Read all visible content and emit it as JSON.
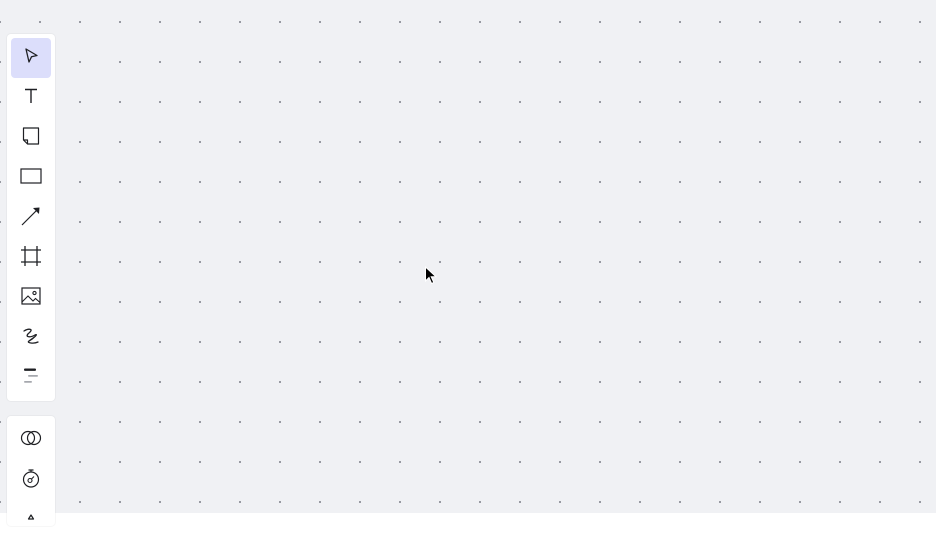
{
  "toolbar": {
    "main_tools": [
      {
        "name": "select",
        "icon": "pointer-icon",
        "active": true
      },
      {
        "name": "text",
        "icon": "text-icon",
        "active": false
      },
      {
        "name": "sticky-note",
        "icon": "sticky-note-icon",
        "active": false
      },
      {
        "name": "shape",
        "icon": "rectangle-icon",
        "active": false
      },
      {
        "name": "connection-line",
        "icon": "arrow-line-icon",
        "active": false
      },
      {
        "name": "frame",
        "icon": "frame-icon",
        "active": false
      },
      {
        "name": "image",
        "icon": "image-icon",
        "active": false
      },
      {
        "name": "pen",
        "icon": "pen-icon",
        "active": false
      },
      {
        "name": "templates",
        "icon": "menu-lines-icon",
        "active": false
      }
    ],
    "secondary_tools": [
      {
        "name": "venn",
        "icon": "venn-circles-icon",
        "active": false
      },
      {
        "name": "timer",
        "icon": "timer-icon",
        "active": false
      },
      {
        "name": "more",
        "icon": "more-icon",
        "active": false
      }
    ]
  },
  "colors": {
    "canvas_background": "#f0f1f4",
    "grid_dot": "#8a8d95",
    "toolbar_background": "#ffffff",
    "active_tool_background": "#dcdefb",
    "icon_stroke": "#1f2024"
  }
}
